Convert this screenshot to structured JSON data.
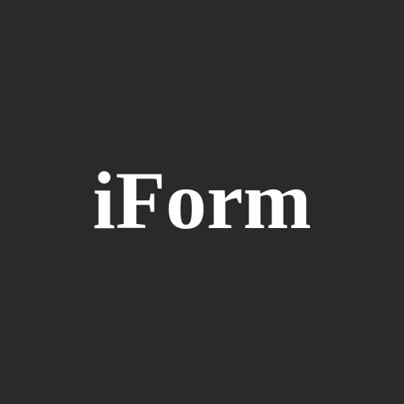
{
  "app": {
    "name": "iForm"
  },
  "colors": {
    "background": "#2a2a2a",
    "text": "#ffffff"
  }
}
